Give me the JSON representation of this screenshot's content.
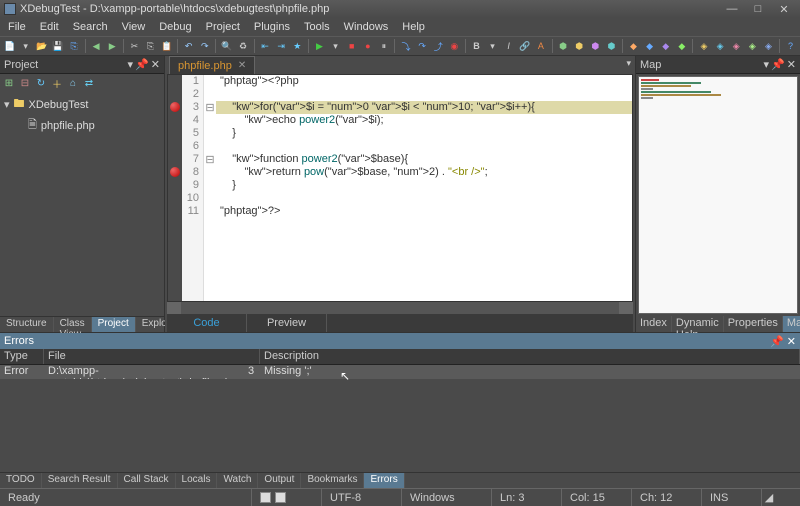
{
  "window": {
    "title": "XDebugTest - D:\\xampp-portable\\htdocs\\xdebugtest\\phpfile.php"
  },
  "menu": [
    "File",
    "Edit",
    "Search",
    "View",
    "Debug",
    "Project",
    "Plugins",
    "Tools",
    "Windows",
    "Help"
  ],
  "project_panel": {
    "title": "Project",
    "root": "XDebugTest",
    "files": [
      "phpfile.php"
    ]
  },
  "editor": {
    "tab": "phpfile.php",
    "lines": [
      {
        "n": 1,
        "raw": "<?php"
      },
      {
        "n": 2,
        "raw": ""
      },
      {
        "n": 3,
        "raw": "    for($i = 0 $i < 10; $i++){",
        "bp": true,
        "hl": true,
        "fold": "-"
      },
      {
        "n": 4,
        "raw": "        echo power2($i);"
      },
      {
        "n": 5,
        "raw": "    }"
      },
      {
        "n": 6,
        "raw": ""
      },
      {
        "n": 7,
        "raw": "    function power2($base){",
        "fold": "-"
      },
      {
        "n": 8,
        "raw": "        return pow($base, 2) . \"<br />\";",
        "bp": true
      },
      {
        "n": 9,
        "raw": "    }"
      },
      {
        "n": 10,
        "raw": ""
      },
      {
        "n": 11,
        "raw": "?>"
      }
    ],
    "code_tabs": {
      "code": "Code",
      "preview": "Preview"
    }
  },
  "left_tabs": [
    "Structure",
    "Class View",
    "Project",
    "Explorer"
  ],
  "right_tabs": [
    "Index",
    "Dynamic Help",
    "Properties",
    "Map"
  ],
  "map_panel": {
    "title": "Map"
  },
  "errors_panel": {
    "title": "Errors",
    "columns": {
      "type": "Type",
      "file": "File",
      "desc": "Description"
    },
    "rows": [
      {
        "type": "Error",
        "file": "D:\\xampp-portable\\htdocs\\xdebugtest\\phpfile.php",
        "line": "3",
        "desc": "Missing ';'"
      }
    ]
  },
  "bottom_tabs": [
    "TODO",
    "Search Result",
    "Call Stack",
    "Locals",
    "Watch",
    "Output",
    "Bookmarks",
    "Errors"
  ],
  "status": {
    "ready": "Ready",
    "encoding": "UTF-8",
    "eol": "Windows",
    "line": "Ln: 3",
    "col": "Col: 15",
    "ch": "Ch: 12",
    "mode": "INS"
  }
}
